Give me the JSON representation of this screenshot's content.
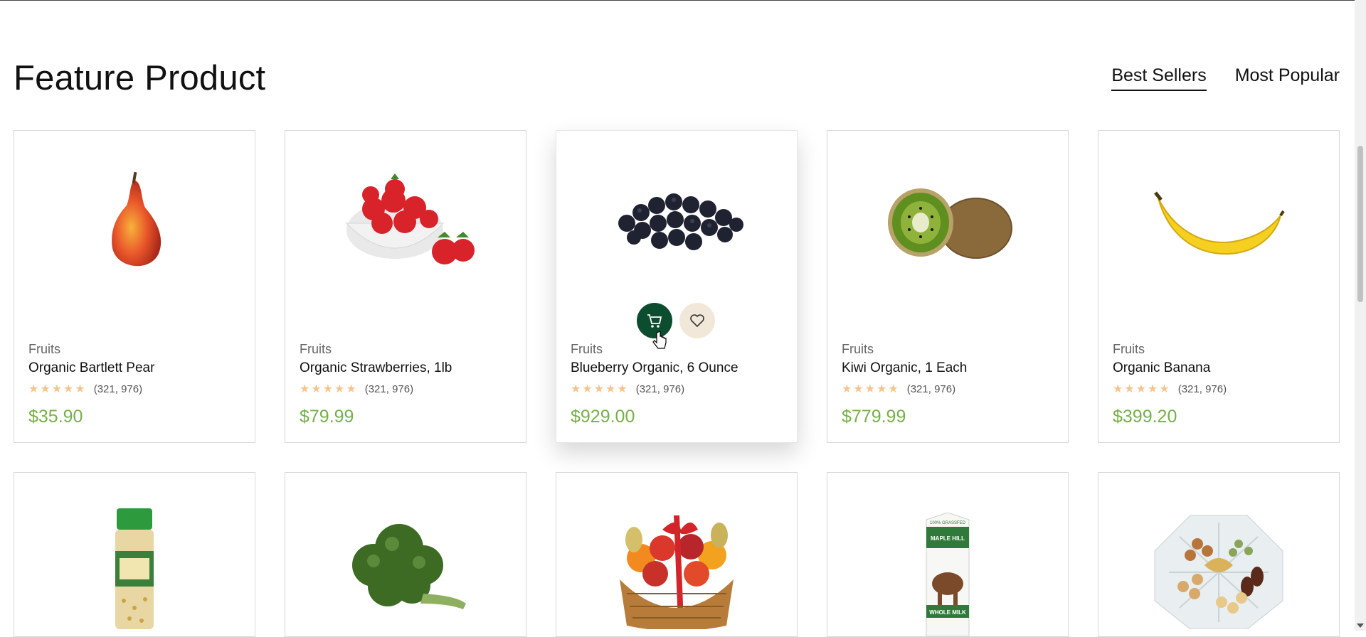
{
  "section": {
    "title": "Feature Product",
    "tabs": [
      {
        "label": "Best Sellers",
        "active": true
      },
      {
        "label": "Most Popular",
        "active": false
      }
    ]
  },
  "products": [
    {
      "category": "Fruits",
      "name": "Organic Bartlett Pear",
      "stars": "★★★★★",
      "reviews": "(321, 976)",
      "price": "$35.90",
      "image": "pear"
    },
    {
      "category": "Fruits",
      "name": "Organic Strawberries, 1lb",
      "stars": "★★★★★",
      "reviews": "(321, 976)",
      "price": "$79.99",
      "image": "strawberries"
    },
    {
      "category": "Fruits",
      "name": "Blueberry Organic, 6 Ounce",
      "stars": "★★★★★",
      "reviews": "(321, 976)",
      "price": "$929.00",
      "image": "blueberries"
    },
    {
      "category": "Fruits",
      "name": "Kiwi Organic, 1 Each",
      "stars": "★★★★★",
      "reviews": "(321, 976)",
      "price": "$779.99",
      "image": "kiwi"
    },
    {
      "category": "Fruits",
      "name": "Organic Banana",
      "stars": "★★★★★",
      "reviews": "(321, 976)",
      "price": "$399.20",
      "image": "banana"
    }
  ],
  "products_row2": [
    {
      "image": "spice-jar"
    },
    {
      "image": "broccoli"
    },
    {
      "image": "fruit-basket"
    },
    {
      "image": "milk-carton"
    },
    {
      "image": "nut-platter"
    }
  ],
  "milk_label": {
    "brand": "MAPLE HILL",
    "product": "WHOLE MILK",
    "tag": "100% GRASSFED"
  },
  "colors": {
    "accent_green": "#0b4d2e",
    "price_green": "#76b046",
    "star": "#f6c48d",
    "wish_bg": "#f2e8d9"
  }
}
